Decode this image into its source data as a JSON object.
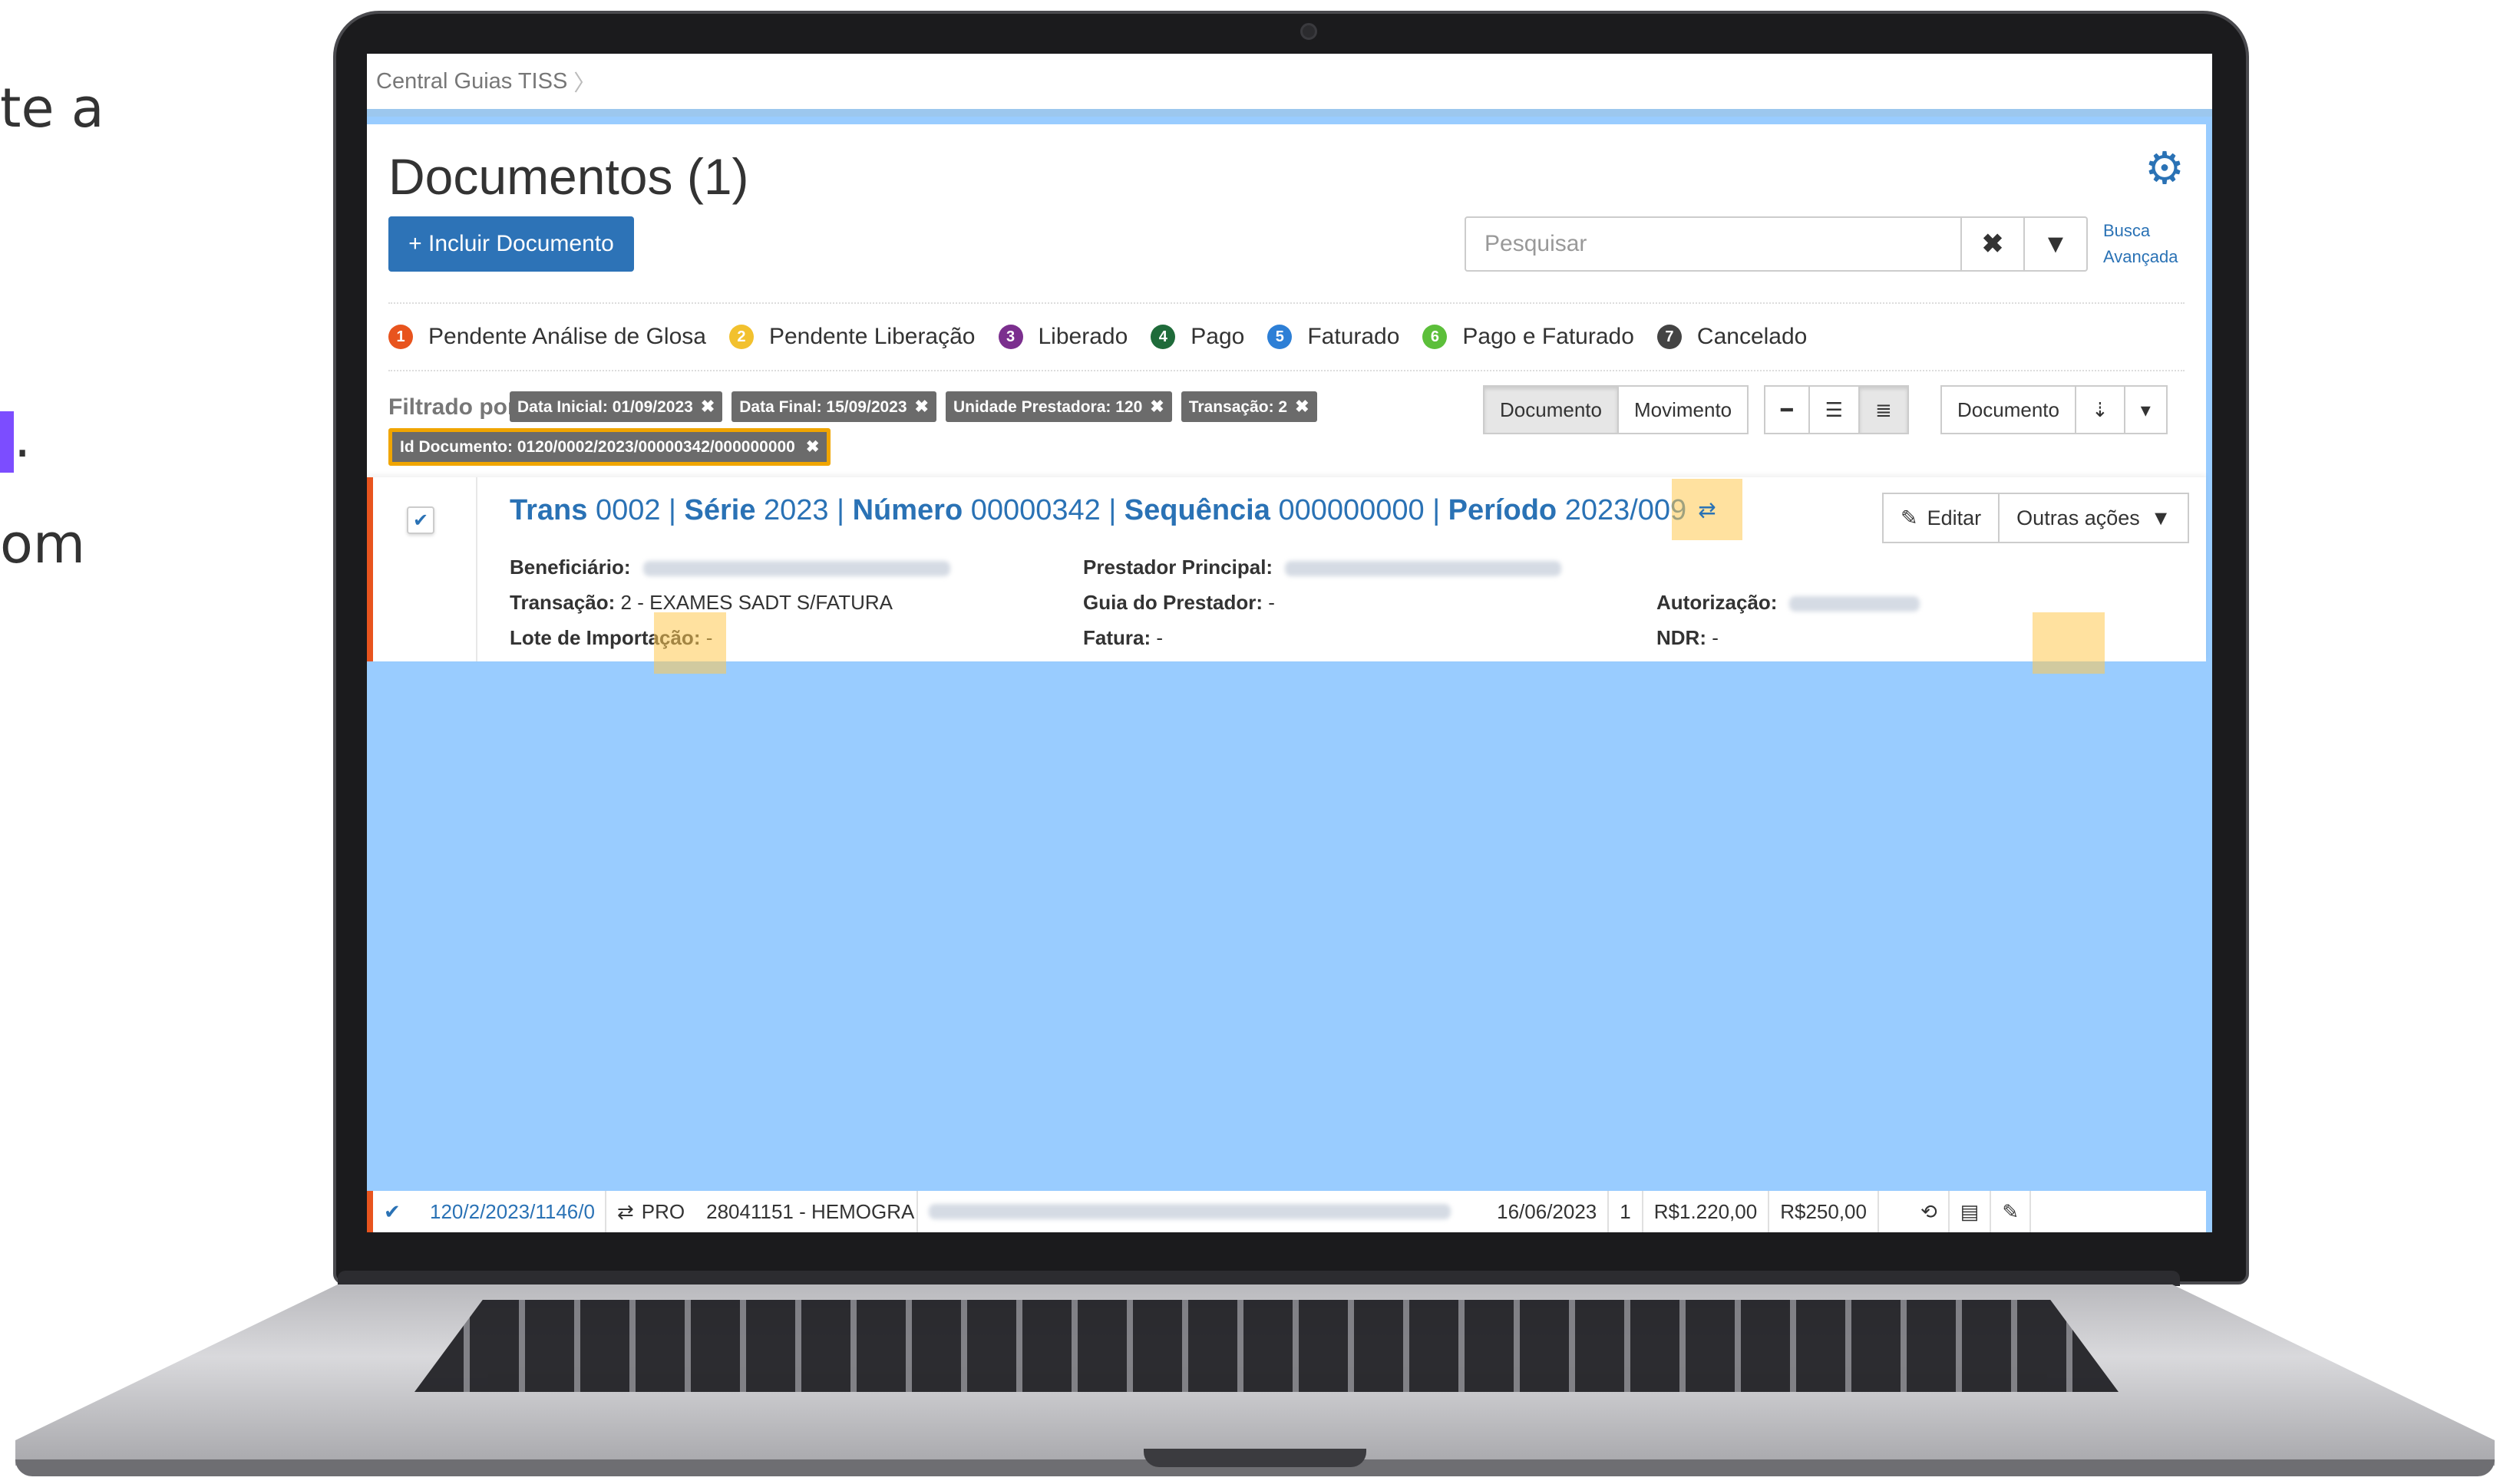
{
  "side_text": {
    "line1": "te a",
    "line2_end": ".",
    "line3": "om"
  },
  "breadcrumb": {
    "item": "Central Guias TISS",
    "separator": "〉"
  },
  "header": {
    "title": "Documentos (1)",
    "add_button": "+ Incluir Documento",
    "search_placeholder": "Pesquisar",
    "advanced_search_line1": "Busca",
    "advanced_search_line2": "Avançada"
  },
  "status_legend": [
    {
      "number": "1",
      "label": "Pendente Análise de Glosa",
      "color": "#e8541e"
    },
    {
      "number": "2",
      "label": "Pendente Liberação",
      "color": "#f2c12e"
    },
    {
      "number": "3",
      "label": "Liberado",
      "color": "#7b2f8e"
    },
    {
      "number": "4",
      "label": "Pago",
      "color": "#1f6b3a"
    },
    {
      "number": "5",
      "label": "Faturado",
      "color": "#2d7fd6"
    },
    {
      "number": "6",
      "label": "Pago e Faturado",
      "color": "#5cbf3a"
    },
    {
      "number": "7",
      "label": "Cancelado",
      "color": "#444444"
    }
  ],
  "filters": {
    "label": "Filtrado por:",
    "chips": [
      "Data Inicial: 01/09/2023",
      "Data Final: 15/09/2023",
      "Unidade Prestadora: 120",
      "Transação: 2"
    ],
    "id_chip": "Id Documento: 0120/0002/2023/00000342/000000000"
  },
  "view_toggle": {
    "document": "Documento",
    "movement": "Movimento"
  },
  "sort": {
    "field": "Documento"
  },
  "document": {
    "title_parts": {
      "trans_label": "Trans",
      "trans_value": "0002",
      "serie_label": "Série",
      "serie_value": "2023",
      "numero_label": "Número",
      "numero_value": "00000342",
      "sequencia_label": "Sequência",
      "sequencia_value": "000000000",
      "periodo_label": "Período",
      "periodo_value": "2023/009"
    },
    "edit_button": "Editar",
    "other_actions": "Outras ações",
    "fields": {
      "beneficiario_label": "Beneficiário:",
      "prestador_label": "Prestador Principal:",
      "transacao_label": "Transação:",
      "transacao_value": "2 - EXAMES SADT S/FATURA",
      "guia_label": "Guia do Prestador:",
      "guia_value": "-",
      "autorizacao_label": "Autorização:",
      "lote_label": "Lote de Importação:",
      "lote_value": "-",
      "fatura_label": "Fatura:",
      "fatura_value": "-",
      "ndr_label": "NDR:",
      "ndr_value": "-"
    }
  },
  "bottom_row": {
    "id": "120/2/2023/1146/0",
    "type": "PRO",
    "procedure": "28041151 - HEMOGRA",
    "date": "16/06/2023",
    "qty": "1",
    "value1": "R$1.220,00",
    "value2": "R$250,00"
  }
}
